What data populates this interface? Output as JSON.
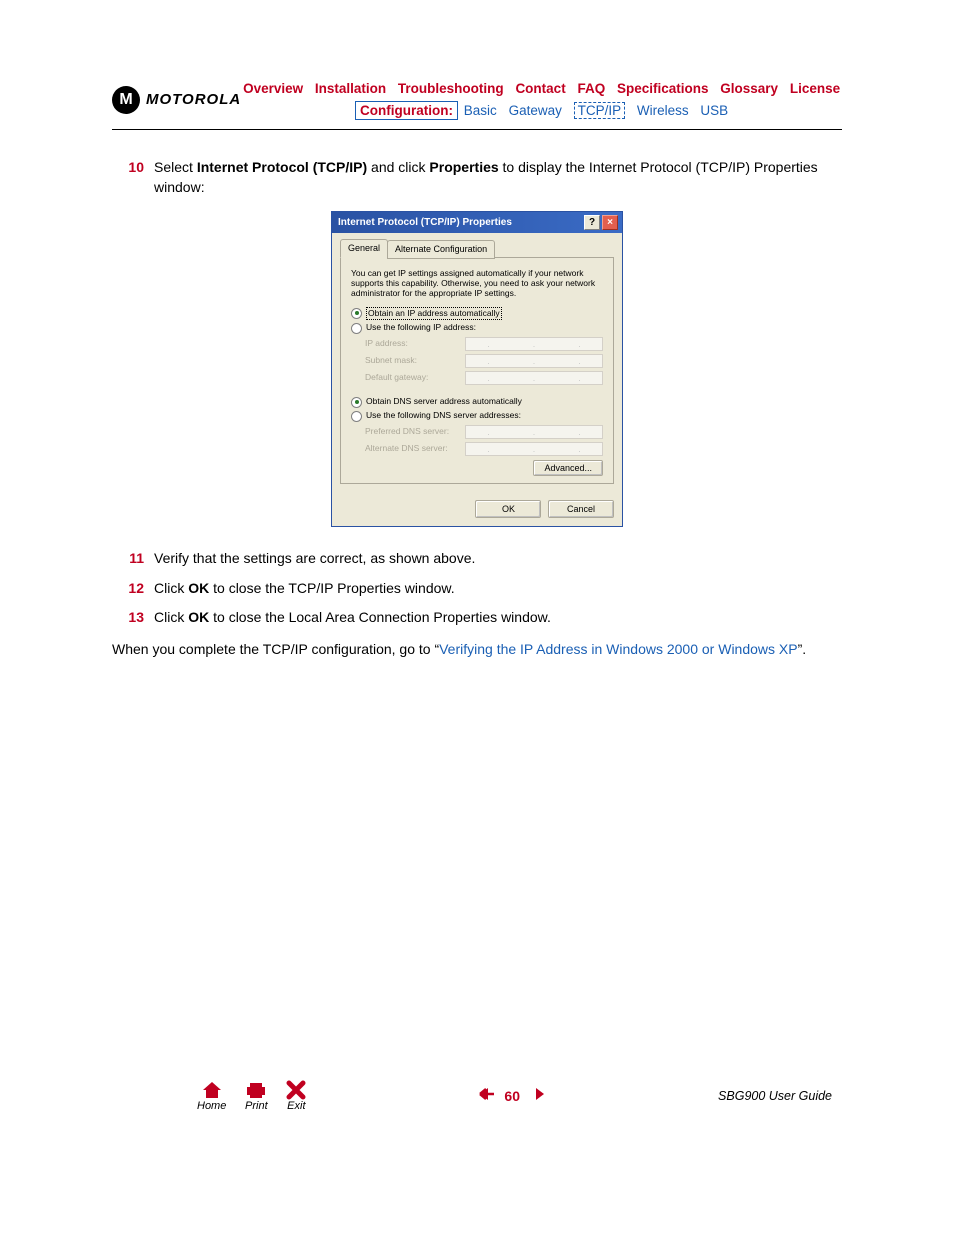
{
  "header": {
    "brand": "MOTOROLA",
    "nav1": [
      "Overview",
      "Installation",
      "Troubleshooting",
      "Contact",
      "FAQ",
      "Specifications",
      "Glossary",
      "License"
    ],
    "config_label": "Configuration:",
    "nav2": [
      "Basic",
      "Gateway",
      "TCP/IP",
      "Wireless",
      "USB"
    ]
  },
  "steps": {
    "s10_num": "10",
    "s10_a": "Select ",
    "s10_b": "Internet Protocol (TCP/IP)",
    "s10_c": " and click ",
    "s10_d": "Properties",
    "s10_e": " to display the Internet Protocol (TCP/IP) Properties window:",
    "s11_num": "11",
    "s11": "Verify that the settings are correct, as shown above.",
    "s12_num": "12",
    "s12_a": "Click ",
    "s12_b": "OK",
    "s12_c": " to close the TCP/IP Properties window.",
    "s13_num": "13",
    "s13_a": "Click ",
    "s13_b": "OK",
    "s13_c": " to close the Local Area Connection Properties window."
  },
  "para": {
    "a": "When you complete the TCP/IP configuration, go to “",
    "link": "Verifying the IP Address in Windows 2000 or Windows XP",
    "b": "”."
  },
  "dialog": {
    "title": "Internet Protocol (TCP/IP) Properties",
    "tab1": "General",
    "tab2": "Alternate Configuration",
    "desc": "You can get IP settings assigned automatically if your network supports this capability. Otherwise, you need to ask your network administrator for the appropriate IP settings.",
    "r1": "Obtain an IP address automatically",
    "r2": "Use the following IP address:",
    "f1": "IP address:",
    "f2": "Subnet mask:",
    "f3": "Default gateway:",
    "r3": "Obtain DNS server address automatically",
    "r4": "Use the following DNS server addresses:",
    "f4": "Preferred DNS server:",
    "f5": "Alternate DNS server:",
    "adv": "Advanced...",
    "ok": "OK",
    "cancel": "Cancel"
  },
  "footer": {
    "home": "Home",
    "print": "Print",
    "exit": "Exit",
    "page": "60",
    "guide": "SBG900 User Guide"
  }
}
